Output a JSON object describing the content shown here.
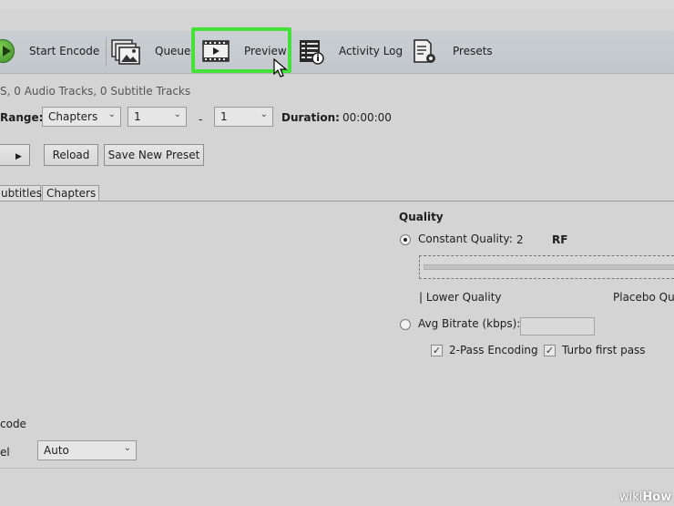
{
  "toolbar": {
    "start_encode": "Start Encode",
    "queue": "Queue",
    "preview": "Preview",
    "activity_log": "Activity Log",
    "presets": "Presets"
  },
  "source_info": "S, 0 Audio Tracks, 0 Subtitle Tracks",
  "range": {
    "label": "Range:",
    "mode": "Chapters",
    "start": "1",
    "dash": "-",
    "end": "1",
    "duration_label": "Duration:",
    "duration_value": "00:00:00"
  },
  "preset_buttons": {
    "reload": "Reload",
    "save_new_preset": "Save New Preset"
  },
  "tabs": [
    "ubtitles",
    "Chapters"
  ],
  "quality": {
    "heading": "Quality",
    "constant_label": "Constant Quality:",
    "constant_value": "2",
    "rf_label": "RF",
    "low_label": "| Lower Quality",
    "high_label": "Placebo Qu",
    "avg_bitrate_label": "Avg Bitrate (kbps):",
    "avg_bitrate_value": "",
    "two_pass_label": "2-Pass Encoding",
    "turbo_label": "Turbo first pass",
    "constant_selected": true,
    "two_pass_checked": true,
    "turbo_checked": true
  },
  "encode": {
    "section_label": "code",
    "level_label": "el",
    "level_value": "Auto"
  },
  "watermark": {
    "wiki": "wiki",
    "how": "How"
  },
  "colors": {
    "highlight": "#45e03a",
    "toolbar": "#c5cacf"
  }
}
